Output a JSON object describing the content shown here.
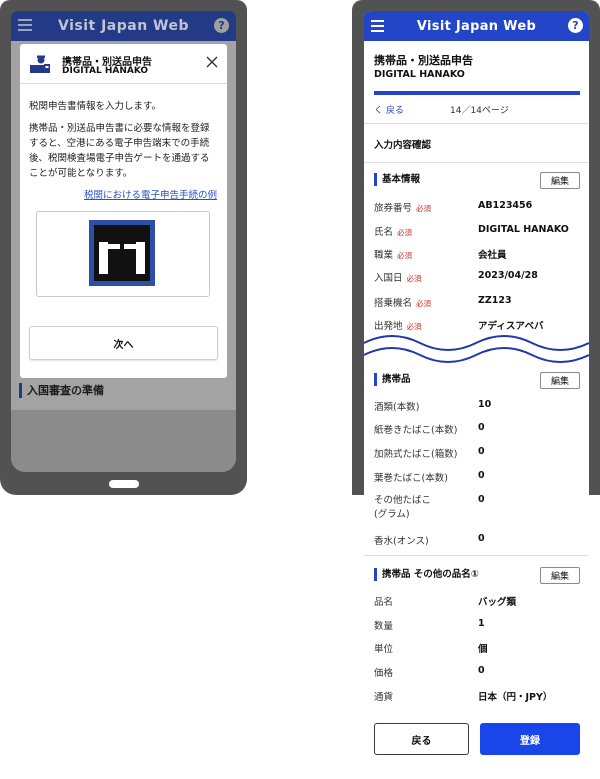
{
  "left_phone": {
    "header": {
      "title": "Visit Japan Web",
      "help": "?"
    },
    "background_section": "入国審査の準備",
    "modal": {
      "title": "携帯品・別送品申告",
      "user": "DIGITAL HANAKO",
      "lead": "税関申告書情報を入力します。",
      "body_lines": [
        "携帯品・別送品申告書に必要な情報を登録",
        "すると、空港にある電子申告端末での手続",
        "後、税関検査場電子申告ゲートを通過する",
        "ことが可能となります。"
      ],
      "link": "税関における電子申告手続の例",
      "next_button": "次へ"
    }
  },
  "right_phone": {
    "header": {
      "title": "Visit Japan Web",
      "help": "?"
    },
    "title": "携帯品・別送品申告",
    "user": "DIGITAL HANAKO",
    "progress": 1.0,
    "back_link": "く 戻る",
    "page_indicator": "14／14ページ",
    "confirm_label": "入力内容確認",
    "required_label": "必須",
    "edit_label": "編集",
    "basic_info": {
      "heading": "基本情報",
      "rows": [
        {
          "label": "旅券番号",
          "value": "AB123456"
        },
        {
          "label": "氏名",
          "value": "DIGITAL HANAKO"
        },
        {
          "label": "職業",
          "value": "会社員"
        },
        {
          "label": "入国日",
          "value": "2023/04/28"
        },
        {
          "label": "搭乗機名",
          "value": "ZZ123"
        },
        {
          "label": "出発地",
          "value": "アディスアベバ"
        }
      ]
    },
    "belongings": {
      "heading": "携帯品",
      "rows": [
        {
          "label": "酒類(本数)",
          "value": "10"
        },
        {
          "label": "紙巻きたばこ(本数)",
          "value": "0"
        },
        {
          "label": "加熱式たばこ(箱数)",
          "value": "0"
        },
        {
          "label": "葉巻たばこ(本数)",
          "value": "0"
        },
        {
          "label": "その他たばこ",
          "label2": "(グラム)",
          "value": "0"
        },
        {
          "label": "香水(オンス)",
          "value": "0"
        }
      ]
    },
    "other_items": {
      "heading": "携帯品 その他の品名①",
      "rows": [
        {
          "label": "品名",
          "value": "バッグ類"
        },
        {
          "label": "数量",
          "value": "1"
        },
        {
          "label": "単位",
          "value": "個"
        },
        {
          "label": "価格",
          "value": "0"
        },
        {
          "label": "通貨",
          "value": "日本（円・JPY）"
        }
      ]
    },
    "back_button": "戻る",
    "register_button": "登録"
  },
  "colors": {
    "header_active": "#2346c9",
    "header_dimmed": "#233a86",
    "register_button": "#1846e8",
    "required": "#d22b2b",
    "link": "#2650cf"
  }
}
